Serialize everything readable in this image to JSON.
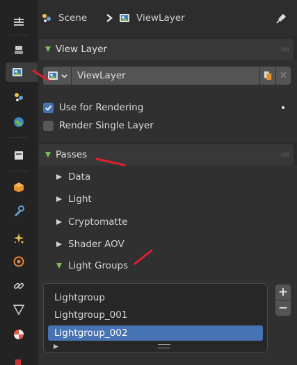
{
  "header": {
    "scene_label": "Scene",
    "viewlayer_label": "ViewLayer"
  },
  "sidebar": {
    "tabs": [
      "tool-icon",
      "render-icon",
      "output-icon",
      "view-layer-icon",
      "scene-icon",
      "world-icon",
      "collection-icon",
      "object-icon",
      "modifier-icon",
      "particles-icon",
      "physics-icon",
      "constraints-icon",
      "data-icon",
      "material-icon"
    ],
    "active_tab": "view-layer-icon"
  },
  "view_layer_panel": {
    "title": "View Layer",
    "current_layer": "ViewLayer",
    "use_for_rendering_label": "Use for Rendering",
    "use_for_rendering": true,
    "render_single_layer_label": "Render Single Layer",
    "render_single_layer": false
  },
  "passes_panel": {
    "title": "Passes",
    "items": [
      {
        "label": "Data",
        "expanded": false
      },
      {
        "label": "Light",
        "expanded": false
      },
      {
        "label": "Cryptomatte",
        "expanded": false
      },
      {
        "label": "Shader AOV",
        "expanded": false
      },
      {
        "label": "Light Groups",
        "expanded": true
      }
    ]
  },
  "light_groups": {
    "items": [
      "Lightgroup",
      "Lightgroup_001",
      "Lightgroup_002"
    ],
    "selected_index": 2,
    "add_label": "+",
    "remove_label": "−"
  },
  "colors": {
    "accent": "#4772b3",
    "panel": "#383838",
    "background": "#2b2b2b",
    "expand_triangle": "#6fae4f",
    "annotation": "#e0202b"
  }
}
